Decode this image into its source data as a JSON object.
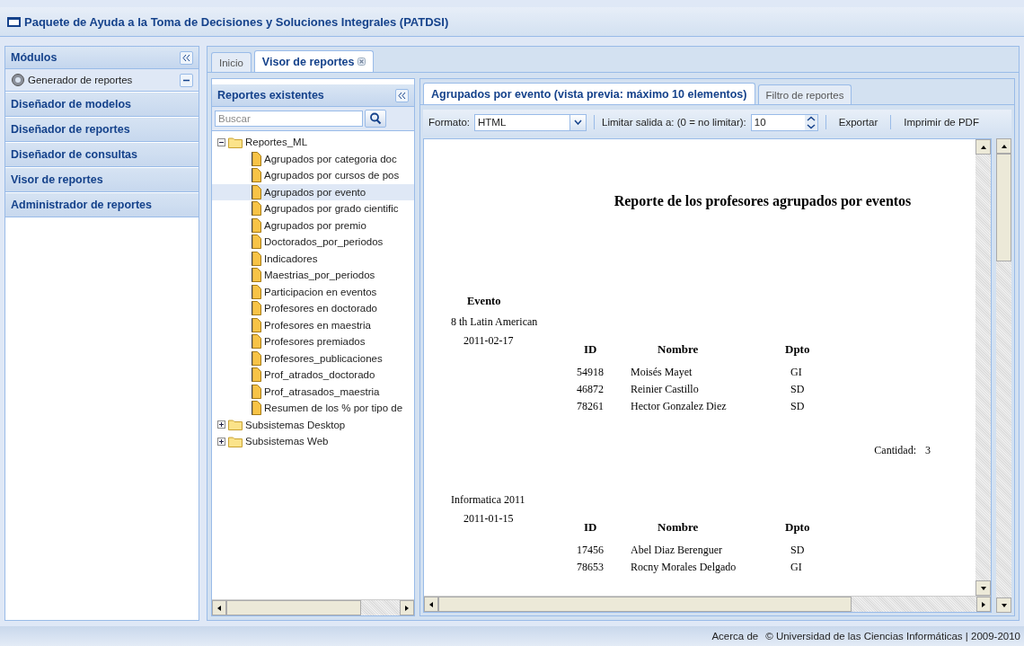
{
  "window": {
    "title": "Paquete de Ayuda a la Toma de Decisiones y Soluciones Integrales (PATDSI)"
  },
  "modules": {
    "title": "Módulos",
    "items": [
      {
        "label": "Generador de reportes",
        "kind": "item",
        "expanded": true
      },
      {
        "label": "Diseñador de modelos",
        "kind": "header"
      },
      {
        "label": "Diseñador de reportes",
        "kind": "header"
      },
      {
        "label": "Diseñador de consultas",
        "kind": "header"
      },
      {
        "label": "Visor de reportes",
        "kind": "header"
      },
      {
        "label": "Administrador de reportes",
        "kind": "header"
      }
    ]
  },
  "tabs": [
    {
      "label": "Inicio",
      "selected": false,
      "closable": false
    },
    {
      "label": "Visor de reportes",
      "selected": true,
      "closable": true
    }
  ],
  "tree_panel": {
    "title": "Reportes existentes",
    "search": {
      "placeholder": "Buscar"
    },
    "tree": [
      {
        "label": "Reportes_ML",
        "expanded": true,
        "children": [
          {
            "label": "Agrupados por categoria doc",
            "selected": false
          },
          {
            "label": "Agrupados por cursos de pos",
            "selected": false
          },
          {
            "label": "Agrupados por evento",
            "selected": true
          },
          {
            "label": "Agrupados por grado cientific",
            "selected": false
          },
          {
            "label": "Agrupados por premio",
            "selected": false
          },
          {
            "label": "Doctorados_por_periodos",
            "selected": false
          },
          {
            "label": "Indicadores",
            "selected": false
          },
          {
            "label": "Maestrias_por_periodos",
            "selected": false
          },
          {
            "label": "Participacion en eventos",
            "selected": false
          },
          {
            "label": "Profesores en doctorado",
            "selected": false
          },
          {
            "label": "Profesores en maestria",
            "selected": false
          },
          {
            "label": "Profesores premiados",
            "selected": false
          },
          {
            "label": "Profesores_publicaciones",
            "selected": false
          },
          {
            "label": "Prof_atrados_doctorado",
            "selected": false
          },
          {
            "label": "Prof_atrasados_maestria",
            "selected": false
          },
          {
            "label": "Resumen de los % por tipo de",
            "selected": false
          }
        ]
      },
      {
        "label": "Subsistemas Desktop",
        "expanded": false
      },
      {
        "label": "Subsistemas Web",
        "expanded": false
      }
    ]
  },
  "viewer": {
    "tabs": [
      {
        "label": "Agrupados por evento (vista previa: máximo 10 elementos)",
        "selected": true
      },
      {
        "label": "Filtro de reportes",
        "selected": false
      }
    ],
    "toolbar": {
      "format_label": "Formato:",
      "format_value": "HTML",
      "limit_label": "Limitar salida a: (0 = no limitar):",
      "limit_value": "10",
      "buttons": [
        "Exportar",
        "Imprimir de PDF"
      ]
    },
    "report": {
      "title": "Reporte de los profesores agrupados por eventos",
      "group_header": "Evento",
      "groups": [
        {
          "event": "8 th Latin American",
          "date": "2011-02-17",
          "columns": [
            "ID",
            "Nombre",
            "Dpto"
          ],
          "rows": [
            [
              "54918",
              "Moisés Mayet",
              "GI"
            ],
            [
              "46872",
              "Reinier Castillo",
              "SD"
            ],
            [
              "78261",
              "Hector Gonzalez Diez",
              "SD"
            ]
          ],
          "total_label": "Cantidad:",
          "total": "3"
        },
        {
          "event": "Informatica 2011",
          "date": "2011-01-15",
          "columns": [
            "ID",
            "Nombre",
            "Dpto"
          ],
          "rows": [
            [
              "17456",
              "Abel Diaz Berenguer",
              "SD"
            ],
            [
              "78653",
              "Rocny Morales Delgado",
              "GI"
            ]
          ]
        }
      ]
    }
  },
  "footer": {
    "link": "Acerca de",
    "copyright": "© Universidad de las Ciencias Informáticas | 2009-2010"
  }
}
